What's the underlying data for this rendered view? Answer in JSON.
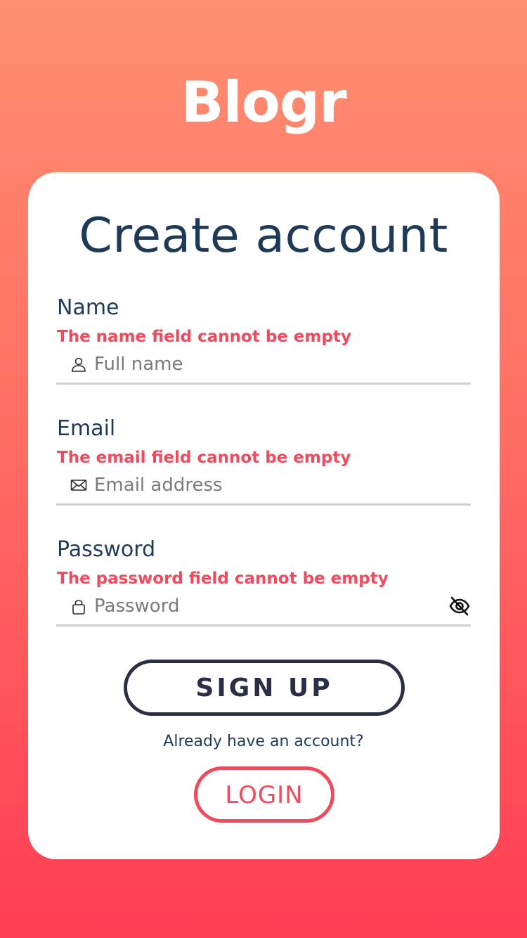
{
  "app": {
    "brand": "Blogr"
  },
  "form": {
    "title": "Create account",
    "name": {
      "label": "Name",
      "error": "The name field cannot be empty",
      "placeholder": "Full name",
      "value": ""
    },
    "email": {
      "label": "Email",
      "error": "The email field cannot be empty",
      "placeholder": "Email address",
      "value": ""
    },
    "password": {
      "label": "Password",
      "error": "The password field cannot be empty",
      "placeholder": "Password",
      "value": ""
    },
    "signup_label": "SIGN UP",
    "already_text": "Already have an account?",
    "login_label": "LOGIN"
  },
  "icons": {
    "name": "user-icon",
    "email": "envelope-icon",
    "password": "lock-icon",
    "toggle": "eye-slash-icon"
  },
  "colors": {
    "gradient_top": "#ff8f70",
    "gradient_bottom": "#ff3d54",
    "heading": "#1f3a57",
    "error": "#f2495c",
    "button_dark": "#2a2f45"
  }
}
